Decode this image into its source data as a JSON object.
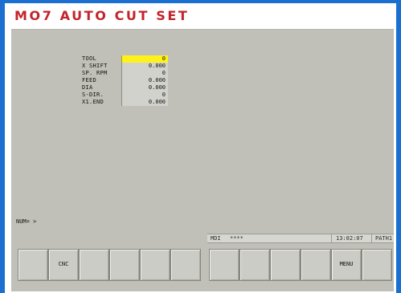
{
  "title": "MO7 AUTO CUT SET",
  "params": [
    {
      "label": "TOOL",
      "value": "0",
      "selected": true
    },
    {
      "label": "X SHIFT",
      "value": "0.000",
      "selected": false
    },
    {
      "label": "SP. RPM",
      "value": "0",
      "selected": false
    },
    {
      "label": "FEED",
      "value": "0.000",
      "selected": false
    },
    {
      "label": "DIA",
      "value": "0.000",
      "selected": false
    },
    {
      "label": "S-DIR.",
      "value": "0",
      "selected": false
    },
    {
      "label": "X1.END",
      "value": "0.000",
      "selected": false
    }
  ],
  "prompt": "NUM= >",
  "status": {
    "mode": "MDI",
    "indicator": "****",
    "time": "13:02:07",
    "path": "PATH1"
  },
  "softkeys": [
    "",
    "CNC",
    "",
    "",
    "",
    "",
    "",
    "",
    "",
    "",
    "MENU",
    ""
  ],
  "colors": {
    "border": "#1a6fd0",
    "title": "#c2242b",
    "screen": "#c0c0b8",
    "selected_field": "#fff21b"
  }
}
